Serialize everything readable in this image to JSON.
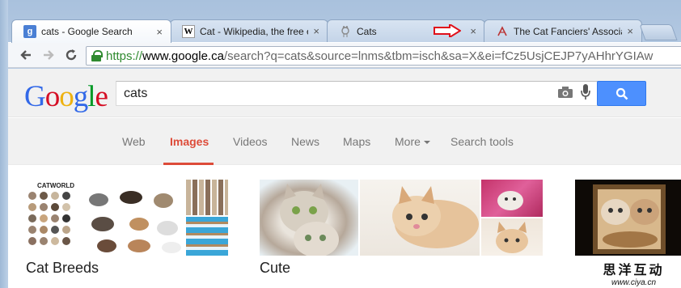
{
  "tabs": [
    {
      "title": "cats - Google Search",
      "favicon": "google-g-icon",
      "favicon_text": "g",
      "active": true
    },
    {
      "title": "Cat - Wikipedia, the free e",
      "favicon": "wikipedia-w-icon",
      "favicon_text": "W",
      "active": false
    },
    {
      "title": "Cats",
      "favicon": "cat-site-icon",
      "favicon_text": "",
      "active": false
    },
    {
      "title": "The Cat Fanciers' Associat",
      "favicon": "cfa-icon",
      "favicon_text": "",
      "active": false
    }
  ],
  "tab_close_glyph": "×",
  "omnibox": {
    "scheme": "https://",
    "host": "www.google.ca",
    "rest": "/search?q=cats&source=lnms&tbm=isch&sa=X&ei=fCz5UsjCEJP7yAHhrYGIAw"
  },
  "logo_letters": [
    "G",
    "o",
    "o",
    "g",
    "l",
    "e"
  ],
  "search": {
    "query": "cats"
  },
  "nav": {
    "items": [
      "Web",
      "Images",
      "Videos",
      "News",
      "Maps",
      "More",
      "Search tools"
    ],
    "active": "Images"
  },
  "result_groups": [
    {
      "label": "Cat Breeds"
    },
    {
      "label": "Cute"
    },
    {
      "label": ""
    }
  ],
  "catworld_text": "CATWORLD",
  "watermark": {
    "chinese": "思洋互动",
    "url": "www.ciya.cn"
  },
  "colors": {
    "accent_red": "#dd4b39",
    "search_blue": "#4d90fe",
    "secure_green": "#2f8a2f",
    "annotation_arrow": "#e0101a"
  }
}
